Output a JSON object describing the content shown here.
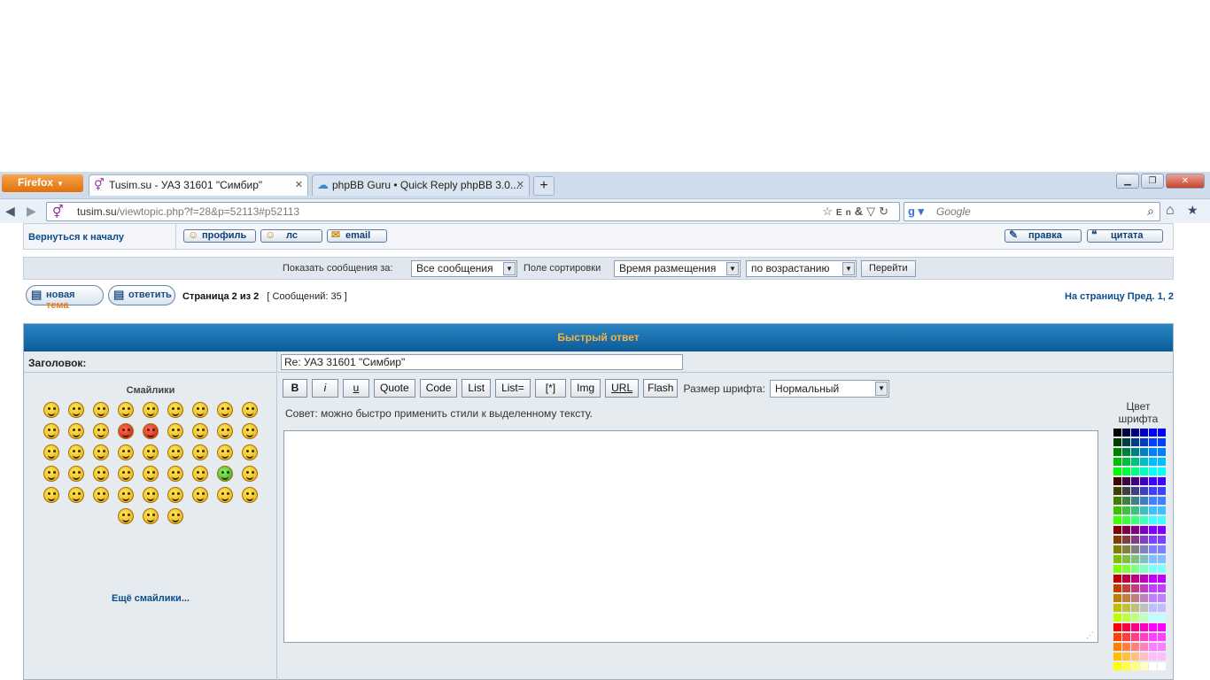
{
  "browser": {
    "app_button": "Firefox",
    "tabs": [
      {
        "title": "Tusim.su - УАЗ 31601 \"Симбир\"",
        "active": true
      },
      {
        "title": "phpBB Guru • Quick Reply phpBB 3.0....",
        "active": false
      }
    ],
    "url_host": "tusim.su",
    "url_path": "/viewtopic.php?f=28&p=52113#p52113",
    "search_placeholder": "Google"
  },
  "forum": {
    "back_link": "Вернуться к началу",
    "user_buttons": [
      "профиль",
      "лс",
      "email"
    ],
    "post_buttons": [
      "правка",
      "цитата"
    ],
    "sort": {
      "show_label": "Показать сообщения за:",
      "show_value": "Все сообщения",
      "sort_label": "Поле сортировки",
      "sort_value": "Время размещения",
      "order_value": "по возрастанию",
      "go_button": "Перейти"
    },
    "new_topic_prefix": "новая",
    "new_topic_suffix": "тема",
    "reply_button": "ответить",
    "page_info": "Страница 2 из 2",
    "posts_count": "[ Сообщений: 35 ]",
    "pagination": "На страницу Пред.  1, 2"
  },
  "quick_reply": {
    "header": "Быстрый ответ",
    "subject_label": "Заголовок:",
    "subject_value": "Re: УАЗ 31601 \"Симбир\"",
    "smilies_title": "Смайлики",
    "more_smilies": "Ещё смайлики...",
    "smiley_count": 48,
    "toolbar": [
      "B",
      "i",
      "u",
      "Quote",
      "Code",
      "List",
      "List=",
      "[*]",
      "Img",
      "URL",
      "Flash"
    ],
    "font_size_label": "Размер шрифта:",
    "font_size_value": "Нормальный",
    "tip": "Совет: можно быстро применить стили к выделенному тексту.",
    "color_title": "Цвет шрифта"
  }
}
